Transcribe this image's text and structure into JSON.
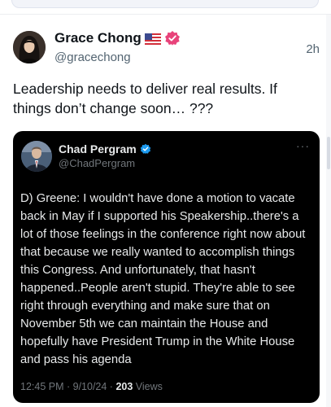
{
  "post": {
    "author_name": "Grace Chong",
    "flag": "🇺🇸",
    "handle": "@gracechong",
    "time": "2h",
    "text": "Leadership needs to deliver real results. If things don’t change soon… ???"
  },
  "quote": {
    "author_name": "Chad Pergram",
    "handle": "@ChadPergram",
    "more": "···",
    "text": "D) Greene: I wouldn't have done a motion to vacate back in May if I supported his Speakership..there's a lot of those feelings in the conference right now about that because we really wanted to accomplish things this Congress. And unfortunately, that hasn't happened..People aren't stupid. They're able to see right through everything and make sure that on November 5th we can maintain the House and hopefully have President Trump in the White House and pass his agenda",
    "timestamp": "12:45 PM · 9/10/24 · ",
    "views_count": "203",
    "views_label": " Views"
  },
  "icons": {
    "verified_post": "verified-badge-pink",
    "verified_quote": "verified-badge-blue",
    "flag": "us-flag-icon"
  },
  "colors": {
    "verified_pink": "#e8437a",
    "verified_blue": "#1d9bf0",
    "text_primary": "#0f1419",
    "text_secondary": "#536471",
    "quote_background": "#000000"
  }
}
